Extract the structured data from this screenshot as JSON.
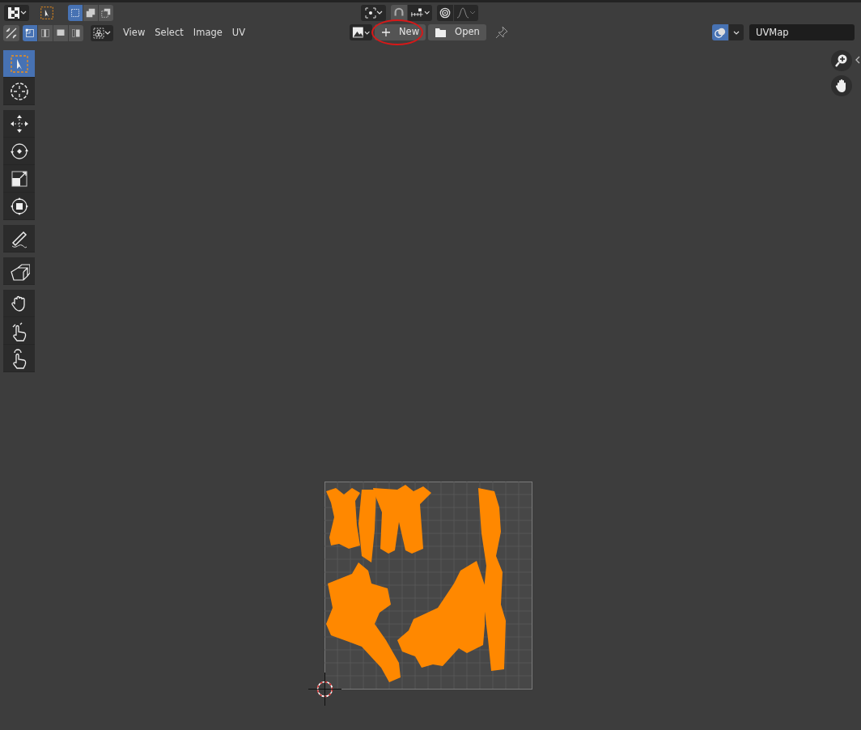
{
  "header_top": {
    "select_modes": [
      {
        "kind": "set",
        "selected": true
      },
      {
        "kind": "extend",
        "selected": false
      },
      {
        "kind": "subtract",
        "selected": false
      }
    ],
    "snap": {
      "on": true
    },
    "proportional": {
      "on": false
    }
  },
  "header": {
    "sync_selection": {
      "on": false
    },
    "uv_select_modes": [
      {
        "kind": "vertex",
        "selected": true
      },
      {
        "kind": "edge",
        "selected": false
      },
      {
        "kind": "face",
        "selected": false
      },
      {
        "kind": "island",
        "selected": false
      }
    ],
    "menus": [
      "View",
      "Select",
      "Image",
      "UV"
    ],
    "buttons": [
      {
        "kind": "new",
        "label": "New",
        "highlighted": true
      },
      {
        "kind": "open",
        "label": "Open",
        "highlighted": false
      }
    ],
    "uv_map_field": {
      "value": "UVMap"
    },
    "overlays": {
      "on": true
    }
  },
  "toolbar": [
    {
      "tools": [
        {
          "kind": "select",
          "selected": true
        },
        {
          "kind": "cursor",
          "selected": false
        }
      ]
    },
    {
      "tools": [
        {
          "kind": "move",
          "selected": false
        },
        {
          "kind": "rotate",
          "selected": false
        },
        {
          "kind": "scale",
          "selected": false
        },
        {
          "kind": "transform",
          "selected": false
        }
      ]
    },
    {
      "tools": [
        {
          "kind": "annotate",
          "selected": false
        }
      ]
    },
    {
      "tools": [
        {
          "kind": "rip",
          "selected": false
        }
      ]
    },
    {
      "tools": [
        {
          "kind": "grab",
          "selected": false
        },
        {
          "kind": "relax",
          "selected": false
        },
        {
          "kind": "pinch",
          "selected": false
        }
      ]
    }
  ]
}
